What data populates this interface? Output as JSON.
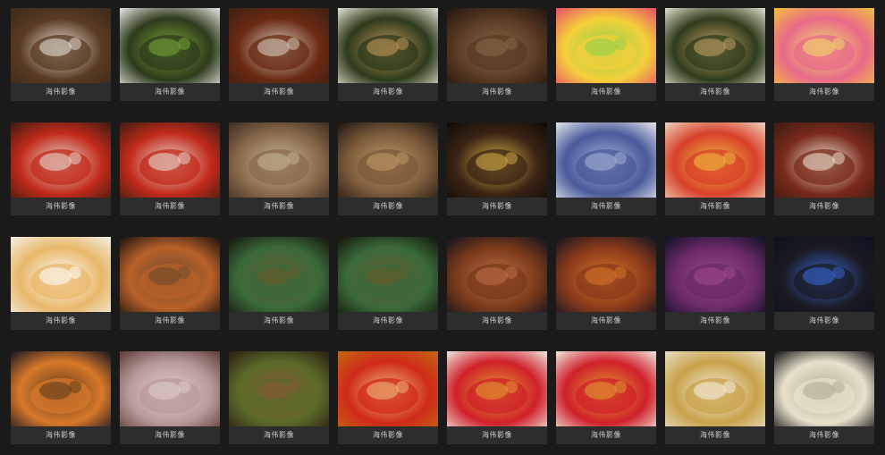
{
  "gallery": {
    "items": [
      {
        "caption": "海伟影像",
        "subject": "coffee-beans-bowl",
        "colors": [
          "#3a2a1c",
          "#5a3b22",
          "#e9e5dc"
        ]
      },
      {
        "caption": "海伟影像",
        "subject": "green-tea-bowl",
        "colors": [
          "#e8ecea",
          "#2e3b1b",
          "#7aa83a"
        ]
      },
      {
        "caption": "海伟影像",
        "subject": "sea-cucumber-chili",
        "colors": [
          "#3b1f14",
          "#6a2a12",
          "#d9d2c6"
        ]
      },
      {
        "caption": "海伟影像",
        "subject": "green-tea-plate",
        "colors": [
          "#e8e4d6",
          "#2d3a1c",
          "#c79a5b"
        ]
      },
      {
        "caption": "海伟影像",
        "subject": "coffee-beans-dark",
        "colors": [
          "#1f1510",
          "#5a3a22",
          "#8a6a4a"
        ]
      },
      {
        "caption": "海伟影像",
        "subject": "colorful-candy",
        "colors": [
          "#e84a6a",
          "#f4d03a",
          "#8cd04a"
        ]
      },
      {
        "caption": "海伟影像",
        "subject": "green-tea-plate-2",
        "colors": [
          "#e6e2d2",
          "#2f3c1c",
          "#c9a468"
        ]
      },
      {
        "caption": "海伟影像",
        "subject": "colorful-candy-2",
        "colors": [
          "#f5c03a",
          "#e86a8a",
          "#f0e06a"
        ]
      },
      {
        "caption": "海伟影像",
        "subject": "sea-cucumber-plate",
        "colors": [
          "#3a1c12",
          "#c22a1a",
          "#e8e0d6"
        ]
      },
      {
        "caption": "海伟影像",
        "subject": "sea-cucumber-plate-2",
        "colors": [
          "#3a1c12",
          "#c22a1a",
          "#e8e0d6"
        ]
      },
      {
        "caption": "海伟影像",
        "subject": "walnuts-chopsticks",
        "colors": [
          "#3a2a20",
          "#8a6a4a",
          "#c8b89a"
        ]
      },
      {
        "caption": "海伟影像",
        "subject": "walnuts-basket",
        "colors": [
          "#1c1512",
          "#7a5a3a",
          "#c49a6a"
        ]
      },
      {
        "caption": "海伟影像",
        "subject": "gold-yin-yang-pendant",
        "colors": [
          "#0e0a08",
          "#3a2414",
          "#d8b04a"
        ]
      },
      {
        "caption": "海伟影像",
        "subject": "crystal-bow-brooch",
        "colors": [
          "#e8eaf0",
          "#4a5a9a",
          "#a8b4d8"
        ]
      },
      {
        "caption": "海伟影像",
        "subject": "drinks-popcorn",
        "colors": [
          "#f0d8c0",
          "#d8402a",
          "#f0c040"
        ]
      },
      {
        "caption": "海伟影像",
        "subject": "tofu-cubes-bowl",
        "colors": [
          "#3a1a12",
          "#7a2a1a",
          "#f2ead8"
        ]
      },
      {
        "caption": "海伟影像",
        "subject": "white-food-spoon",
        "colors": [
          "#f2efe6",
          "#e8b86a",
          "#ffffff"
        ]
      },
      {
        "caption": "海伟影像",
        "subject": "copper-incense-box",
        "colors": [
          "#14100c",
          "#b8602a",
          "#6a4a2a"
        ]
      },
      {
        "caption": "海伟影像",
        "subject": "green-incense-box",
        "colors": [
          "#14120c",
          "#3a6a3a",
          "#6a5a2a"
        ]
      },
      {
        "caption": "海伟影像",
        "subject": "green-incense-box-2",
        "colors": [
          "#14120c",
          "#3a6a3a",
          "#6a5a2a"
        ]
      },
      {
        "caption": "海伟影像",
        "subject": "amber-hair-claw",
        "colors": [
          "#0c1020",
          "#7a3a1a",
          "#c0704a"
        ]
      },
      {
        "caption": "海伟影像",
        "subject": "amber-crystal-earrings",
        "colors": [
          "#0e1222",
          "#8a3a1a",
          "#d8782a"
        ]
      },
      {
        "caption": "海伟影像",
        "subject": "purple-crystal-brooch",
        "colors": [
          "#0c1020",
          "#6a2a6a",
          "#a04a8a"
        ]
      },
      {
        "caption": "海伟影像",
        "subject": "black-crystal-bracelet",
        "colors": [
          "#0c1020",
          "#1a1a22",
          "#3a6ad8"
        ]
      },
      {
        "caption": "海伟影像",
        "subject": "amber-crystal-bracelet",
        "colors": [
          "#0e1222",
          "#d8782a",
          "#5a3a1a"
        ]
      },
      {
        "caption": "海伟影像",
        "subject": "dried-persimmons",
        "colors": [
          "#5a3a34",
          "#b89a9a",
          "#e0d0cc"
        ]
      },
      {
        "caption": "海伟影像",
        "subject": "tea-leaves-pile",
        "colors": [
          "#2a1a10",
          "#5a6a2a",
          "#8a5a34"
        ]
      },
      {
        "caption": "海伟影像",
        "subject": "honey-spoon-red",
        "colors": [
          "#c06a12",
          "#d02a1a",
          "#f0c080"
        ]
      },
      {
        "caption": "海伟影像",
        "subject": "honey-spoon-flowers",
        "colors": [
          "#f0ece4",
          "#d0202a",
          "#e0a030"
        ]
      },
      {
        "caption": "海伟影像",
        "subject": "honey-spoon-flowers-2",
        "colors": [
          "#f0ece4",
          "#d0202a",
          "#e0a030"
        ]
      },
      {
        "caption": "海伟影像",
        "subject": "cream-jar-box",
        "colors": [
          "#e8e0c8",
          "#c8a24a",
          "#f6f2ea"
        ]
      },
      {
        "caption": "海伟影像",
        "subject": "cream-jar-pearls",
        "colors": [
          "#0c0c0c",
          "#e8e0cc",
          "#b0a890"
        ]
      }
    ]
  }
}
